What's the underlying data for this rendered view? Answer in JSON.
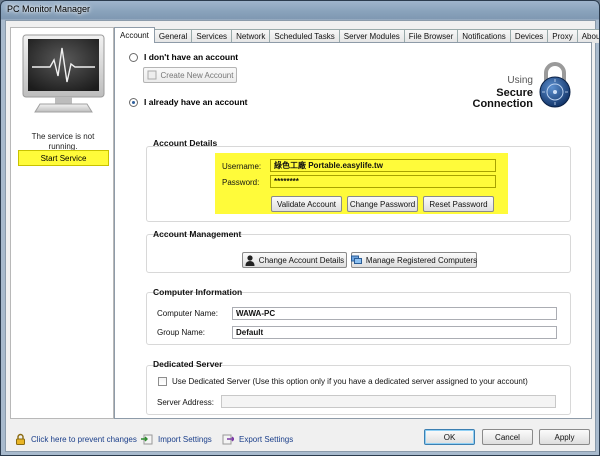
{
  "window": {
    "title": "PC Monitor Manager"
  },
  "left_panel": {
    "status_line1": "The service is not",
    "status_line2": "running.",
    "start_button": "Start Service"
  },
  "tabs": [
    {
      "label": "Account",
      "active": true
    },
    {
      "label": "General",
      "active": false
    },
    {
      "label": "Services",
      "active": false
    },
    {
      "label": "Network",
      "active": false
    },
    {
      "label": "Scheduled Tasks",
      "active": false
    },
    {
      "label": "Server Modules",
      "active": false
    },
    {
      "label": "File Browser",
      "active": false
    },
    {
      "label": "Notifications",
      "active": false
    },
    {
      "label": "Devices",
      "active": false
    },
    {
      "label": "Proxy",
      "active": false
    },
    {
      "label": "About",
      "active": false
    }
  ],
  "account": {
    "no_account_label": "I don't have an account",
    "create_account_button": "Create New Account",
    "have_account_label": "I already have an account",
    "logo": {
      "using": "Using",
      "secure": "Secure",
      "connection": "Connection"
    },
    "details": {
      "title": "Account Details",
      "username_label": "Username:",
      "username_value": "綠色工廠 Portable.easylife.tw",
      "password_label": "Password:",
      "password_value": "********",
      "validate_button": "Validate Account",
      "change_password_button": "Change Password",
      "reset_password_button": "Reset Password"
    },
    "management": {
      "title": "Account Management",
      "change_details_button": "Change Account Details",
      "manage_computers_button": "Manage Registered Computers"
    },
    "computer_info": {
      "title": "Computer Information",
      "computer_name_label": "Computer Name:",
      "computer_name_value": "WAWA-PC",
      "group_name_label": "Group Name:",
      "group_name_value": "Default"
    },
    "dedicated_server": {
      "title": "Dedicated Server",
      "checkbox_label": "Use Dedicated Server (Use this option only if you have a dedicated server assigned to your account)",
      "server_address_label": "Server Address:",
      "server_address_value": ""
    }
  },
  "footer": {
    "prevent_changes_link": "Click here to prevent changes",
    "import_link": "Import Settings",
    "export_link": "Export Settings",
    "ok_button": "OK",
    "cancel_button": "Cancel",
    "apply_button": "Apply"
  },
  "colors": {
    "highlight": "#fffb3a",
    "window_frame": "#8aa3bc",
    "link": "#1a3e8a"
  },
  "icons": [
    "monitor-heartbeat-icon",
    "padlock-icon",
    "user-icon",
    "computers-icon",
    "lock-small-icon",
    "import-icon",
    "export-icon"
  ]
}
